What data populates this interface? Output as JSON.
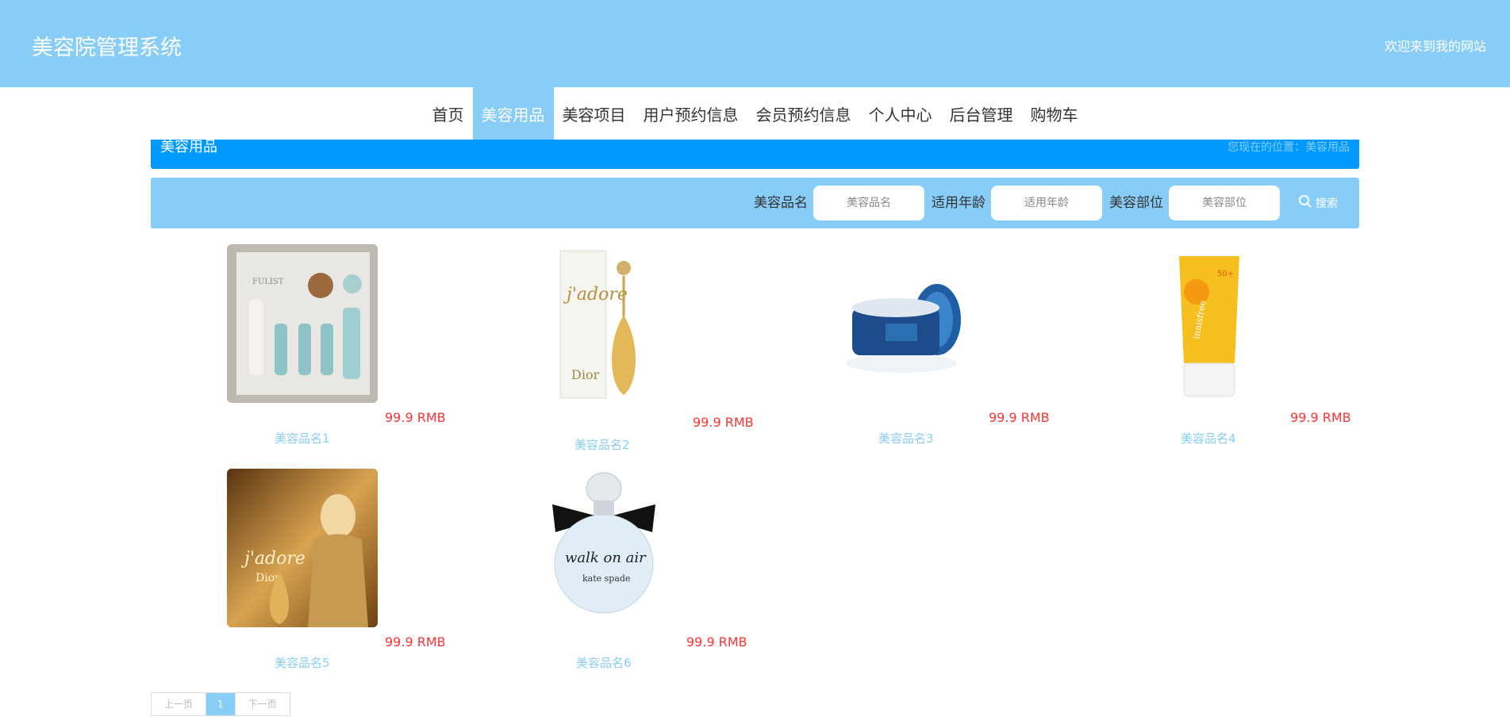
{
  "header": {
    "title": "美容院管理系统",
    "welcome": "欢迎来到我的网站"
  },
  "nav": {
    "items": [
      {
        "label": "首页"
      },
      {
        "label": "美容用品"
      },
      {
        "label": "美容项目"
      },
      {
        "label": "用户预约信息"
      },
      {
        "label": "会员预约信息"
      },
      {
        "label": "个人中心"
      },
      {
        "label": "后台管理"
      },
      {
        "label": "购物车"
      }
    ],
    "active_index": 1
  },
  "breadcrumb": {
    "title": "美容用品",
    "location": "您现在的位置：美容用品"
  },
  "search": {
    "fields": [
      {
        "label": "美容品名",
        "placeholder": "美容品名"
      },
      {
        "label": "适用年龄",
        "placeholder": "适用年龄"
      },
      {
        "label": "美容部位",
        "placeholder": "美容部位"
      }
    ],
    "button_label": "搜索",
    "button_icon": "search-icon"
  },
  "products": [
    {
      "name": "美容品名1",
      "price": "99.9 RMB",
      "image": "skincare-set"
    },
    {
      "name": "美容品名2",
      "price": "99.9 RMB",
      "image": "perfume-bottle-gold"
    },
    {
      "name": "美容品名3",
      "price": "99.9 RMB",
      "image": "cream-jar-blue"
    },
    {
      "name": "美容品名4",
      "price": "99.9 RMB",
      "image": "sunscreen-tube"
    },
    {
      "name": "美容品名5",
      "price": "99.9 RMB",
      "image": "perfume-ad-gold"
    },
    {
      "name": "美容品名6",
      "price": "99.9 RMB",
      "image": "perfume-walk-on-air"
    }
  ],
  "pagination": {
    "prev": "上一页",
    "current": "1",
    "next": "下一页"
  },
  "colors": {
    "primary": "#87cdf7",
    "accent": "#0099ff",
    "price": "#ff3333",
    "text": "#333333"
  }
}
